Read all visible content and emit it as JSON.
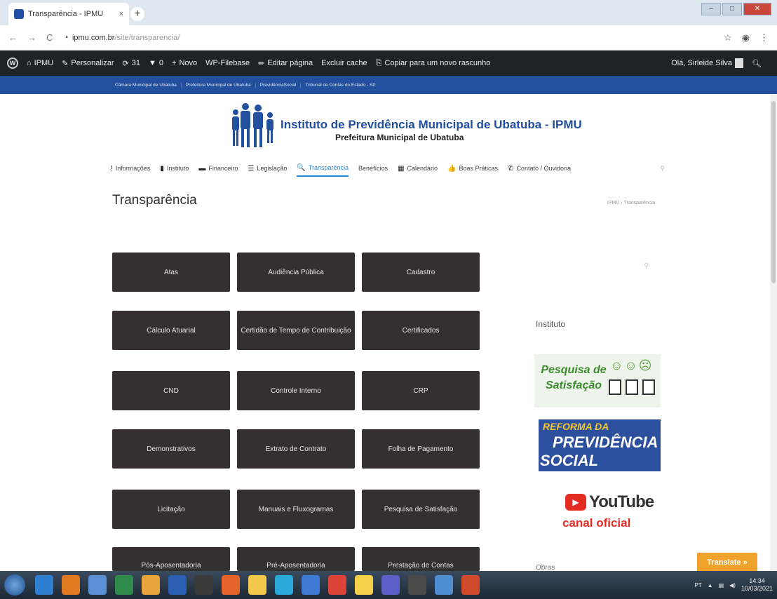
{
  "browser": {
    "tab_title": "Transparência - IPMU",
    "tab_close": "×",
    "new_tab": "+",
    "url_host": "ipmu.com.br",
    "url_path": "/site/transparencia/"
  },
  "adminbar": {
    "site": "IPMU",
    "customize": "Personalizar",
    "updates": "31",
    "comments": "0",
    "new": "Novo",
    "filebase": "WP-Filebase",
    "edit": "Editar página",
    "cache": "Excluir cache",
    "copy": "Copiar para um novo rascunho",
    "greeting": "Olá, Sirleide Silva"
  },
  "linksbar": [
    "Câmara Municipal de Ubatuba",
    "Prefeitura Municipal de Ubatuba",
    "PrevidênciaSocial",
    "Tribunal de Contas do Estado - SP"
  ],
  "header": {
    "title": "Instituto de Previdência Municipal de Ubatuba - IPMU",
    "subtitle": "Prefeitura Municipal de Ubatuba"
  },
  "nav": [
    {
      "label": "Informações",
      "icon": "!"
    },
    {
      "label": "Instituto",
      "icon": "▮"
    },
    {
      "label": "Financeiro",
      "icon": "▬"
    },
    {
      "label": "Legislação",
      "icon": "☰"
    },
    {
      "label": "Transparência",
      "icon": "🔍"
    },
    {
      "label": "Benefícios",
      "icon": ""
    },
    {
      "label": "Calendário",
      "icon": "▦"
    },
    {
      "label": "Boas Práticas",
      "icon": "👍"
    },
    {
      "label": "Contato / Ouvidoria",
      "icon": "✆"
    }
  ],
  "page": {
    "title": "Transparência",
    "breadcrumb": "IPMU › Transparência"
  },
  "buttons": [
    "Atas",
    "Audiência Pública",
    "Cadastro",
    "Cálculo Atuarial",
    "Certidão de Tempo de Contribuição",
    "Certificados",
    "CND",
    "Controle Interno",
    "CRP",
    "Demonstrativos",
    "Extrato de Contrato",
    "Folha de Pagamento",
    "Licitação",
    "Manuais e Fluxogramas",
    "Pesquisa de Satisfação",
    "Pós-Aposentadoria",
    "Pré-Aposentadoria",
    "Prestação de Contas"
  ],
  "sidebar": {
    "title": "Instituto",
    "survey_banner": "Pesquisa de Satisfação",
    "reform_line1": "REFORMA DA",
    "reform_line2": "PREVIDÊNCIA",
    "reform_line3": "SOCIAL",
    "youtube": "YouTube",
    "youtube_sub": "canal oficial",
    "clipped": "Obras"
  },
  "translate": "Translate »",
  "taskbar": {
    "lang": "PT",
    "time": "14:34",
    "date": "10/03/2021"
  }
}
